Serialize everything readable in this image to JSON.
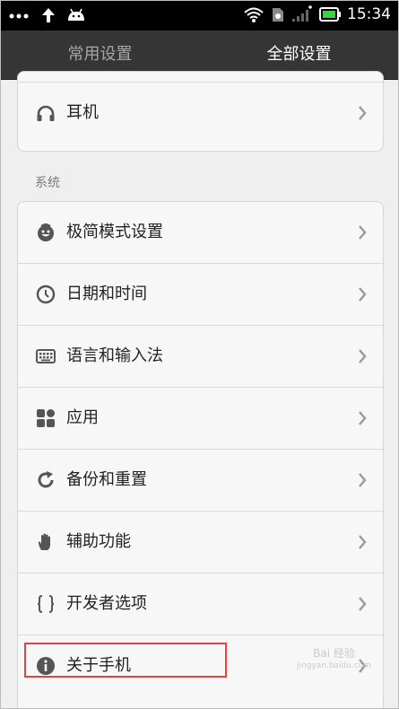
{
  "status_bar": {
    "time": "15:34",
    "left_icons": [
      "more-dots-icon",
      "upload-arrow-icon",
      "android-robot-icon"
    ],
    "right_icons": [
      "wifi-icon",
      "sim-card-icon",
      "signal-icon",
      "battery-icon"
    ]
  },
  "tabs": [
    {
      "label": "常用设置",
      "active": false
    },
    {
      "label": "全部设置",
      "active": true
    }
  ],
  "top_card": {
    "items": [
      {
        "label": "耳机",
        "icon": "headphones-icon"
      }
    ]
  },
  "system_section": {
    "title": "系统",
    "items": [
      {
        "label": "极简模式设置",
        "icon": "smiley-icon"
      },
      {
        "label": "日期和时间",
        "icon": "clock-icon"
      },
      {
        "label": "语言和输入法",
        "icon": "keyboard-icon"
      },
      {
        "label": "应用",
        "icon": "apps-grid-icon"
      },
      {
        "label": "备份和重置",
        "icon": "backup-icon"
      },
      {
        "label": "辅助功能",
        "icon": "hand-icon"
      },
      {
        "label": "开发者选项",
        "icon": "braces-icon"
      },
      {
        "label": "关于手机",
        "icon": "info-icon"
      }
    ]
  },
  "watermark": {
    "line1": "Bai 经验",
    "line2": "jingyan.baidu.com"
  },
  "colors": {
    "highlight": "#e8423e",
    "tab_bar": "#353535",
    "icon": "#555555"
  }
}
